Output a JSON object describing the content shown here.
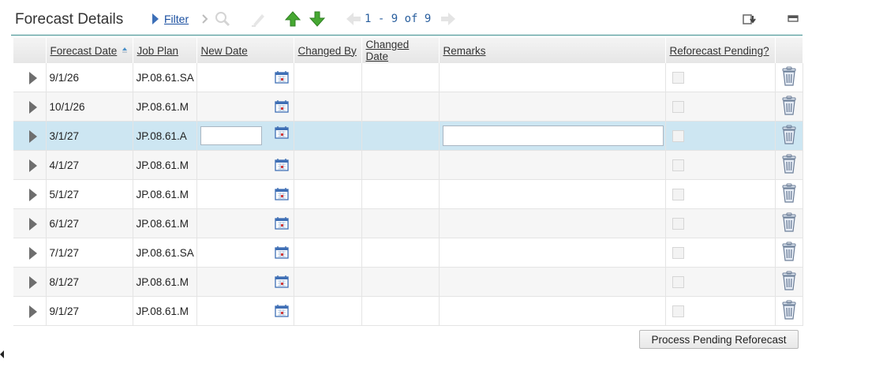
{
  "section": {
    "title": "Forecast Details",
    "filter_label": "Filter",
    "pager": "1 - 9 of 9"
  },
  "columns": {
    "forecast_date": "Forecast Date",
    "job_plan": "Job Plan",
    "new_date": "New Date",
    "changed_by": "Changed By",
    "changed_date": "Changed Date",
    "remarks": "Remarks",
    "reforecast_pending": "Reforecast Pending?"
  },
  "rows": [
    {
      "forecast_date": "9/1/26",
      "job_plan": "JP.08.61.SA"
    },
    {
      "forecast_date": "10/1/26",
      "job_plan": "JP.08.61.M"
    },
    {
      "forecast_date": "3/1/27",
      "job_plan": "JP.08.61.A"
    },
    {
      "forecast_date": "4/1/27",
      "job_plan": "JP.08.61.M"
    },
    {
      "forecast_date": "5/1/27",
      "job_plan": "JP.08.61.M"
    },
    {
      "forecast_date": "6/1/27",
      "job_plan": "JP.08.61.M"
    },
    {
      "forecast_date": "7/1/27",
      "job_plan": "JP.08.61.SA"
    },
    {
      "forecast_date": "8/1/27",
      "job_plan": "JP.08.61.M"
    },
    {
      "forecast_date": "9/1/27",
      "job_plan": "JP.08.61.M"
    }
  ],
  "selected_row": 2,
  "buttons": {
    "process": "Process Pending Reforecast"
  },
  "colors": {
    "header_rule": "#3a8c8c",
    "selected_row": "#cde6f2",
    "link": "#1a4fa0"
  }
}
